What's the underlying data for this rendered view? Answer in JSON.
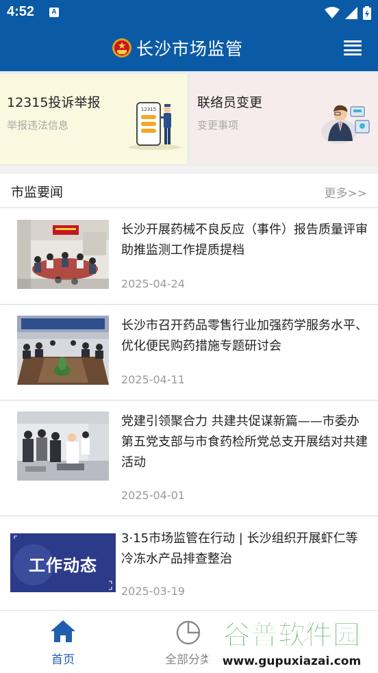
{
  "status_bar": {
    "time": "4:52",
    "notification_glyph": "A"
  },
  "header": {
    "title": "长沙市场监管",
    "menu_icon": "menu-icon",
    "emblem_icon": "national-emblem-icon"
  },
  "quick_cards": [
    {
      "title": "12315投诉举报",
      "subtitle": "举报违法信息",
      "bg": "#fbf8e0",
      "illustration": "phone-officer-illustration",
      "phone_text": "12315"
    },
    {
      "title": "联络员变更",
      "subtitle": "变更事项",
      "bg": "#f7ecec",
      "illustration": "businessman-illustration"
    }
  ],
  "news_section": {
    "title": "市监要闻",
    "more": "更多>>"
  },
  "news": [
    {
      "title": "长沙开展药械不良反应（事件）报告质量评审助推监测工作提质提档",
      "date": "2025-04-24",
      "thumb": "conference-room-photo"
    },
    {
      "title": "长沙市召开药品零售行业加强药学服务水平、优化便民购药措施专题研讨会",
      "date": "2025-04-11",
      "thumb": "meeting-table-photo"
    },
    {
      "title": "党建引领聚合力 共建共促谋新篇——市委办第五党支部与市食药检所党总支开展结对共建活动",
      "date": "2025-04-01",
      "thumb": "laboratory-visit-photo"
    },
    {
      "title": "3·15市场监管在行动 | 长沙组织开展虾仁等冷冻水产品排查整治",
      "date": "2025-03-19",
      "thumb": "work-dynamics-banner",
      "thumb_text": "工作动态"
    }
  ],
  "bottom_nav": [
    {
      "label": "首页",
      "icon": "home-icon",
      "active": true
    },
    {
      "label": "全部分类",
      "icon": "pie-chart-icon",
      "active": false
    },
    {
      "label": "",
      "icon": "user-icon",
      "active": false
    }
  ],
  "watermark": {
    "title": "谷普软件园",
    "url": "www.gupuxiazai.com"
  },
  "colors": {
    "primary": "#0b5aa6",
    "nav_active": "#1f5fae",
    "nav_inactive": "#888888"
  }
}
